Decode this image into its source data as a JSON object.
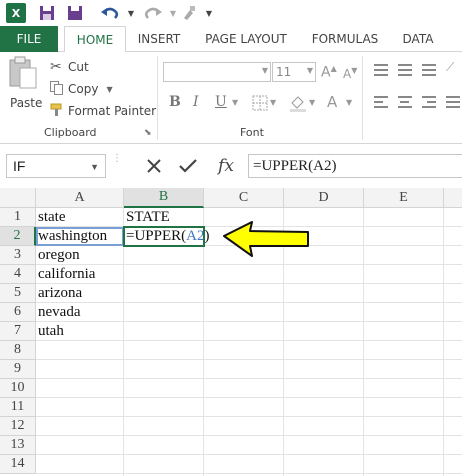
{
  "app": {
    "tabs": [
      {
        "label": "FILE"
      },
      {
        "label": "HOME"
      },
      {
        "label": "INSERT"
      },
      {
        "label": "PAGE LAYOUT"
      },
      {
        "label": "FORMULAS"
      },
      {
        "label": "DATA"
      }
    ]
  },
  "clipboard": {
    "paste_label": "Paste",
    "cut_label": "Cut",
    "copy_label": "Copy",
    "format_painter_label": "Format Painter",
    "group_label": "Clipboard"
  },
  "font": {
    "font_name": "",
    "font_size": "11",
    "group_label": "Font"
  },
  "formula_bar": {
    "name_box": "IF",
    "formula": "=UPPER(A2)"
  },
  "grid": {
    "columns": [
      "A",
      "B",
      "C",
      "D",
      "E"
    ],
    "rows": [
      "1",
      "2",
      "3",
      "4",
      "5",
      "6",
      "7",
      "8",
      "9",
      "10",
      "11",
      "12",
      "13",
      "14"
    ],
    "cells": {
      "A1": "state",
      "B1": "STATE",
      "A2": "washington",
      "B2_prefix": "=UPPER(",
      "B2_ref": "A2",
      "B2_suffix": ")",
      "A3": "oregon",
      "A4": "california",
      "A5": "arizona",
      "A6": "nevada",
      "A7": "utah"
    }
  },
  "colors": {
    "excel_green": "#217346",
    "annotation_arrow": "#ffff00",
    "reference_blue": "#4472c4"
  }
}
